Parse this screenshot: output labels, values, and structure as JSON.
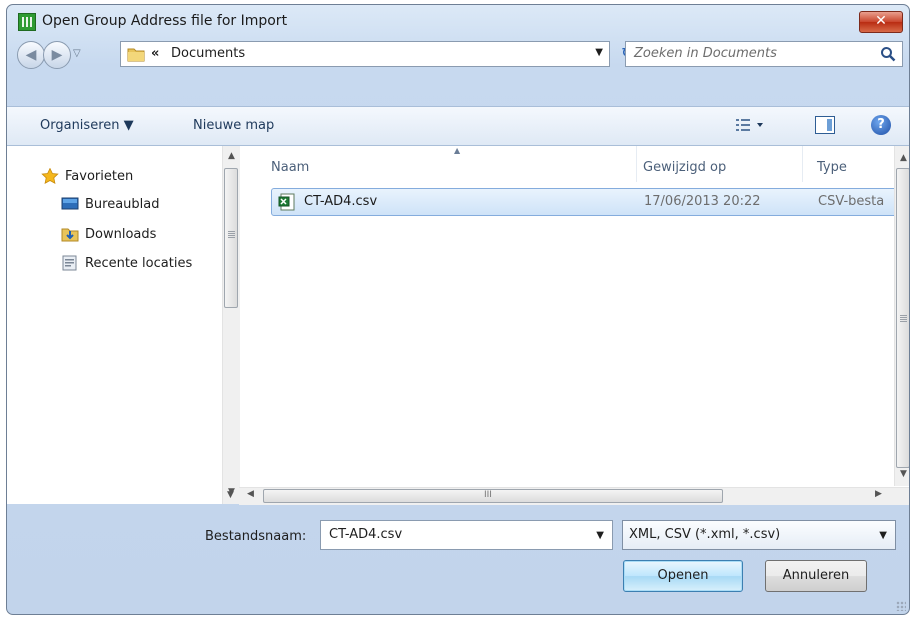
{
  "window": {
    "title": "Open Group Address file for Import",
    "close_glyph": "✕"
  },
  "nav": {
    "back_glyph": "◀",
    "forward_glyph": "▶",
    "history_glyph": "▽",
    "breadcrumb_chevron": "«",
    "address": "Documents",
    "address_drop": "▼",
    "refresh_glyph": "↻",
    "search_placeholder": "Zoeken in Documents"
  },
  "toolbar": {
    "organise": "Organiseren ▼",
    "new_folder": "Nieuwe map",
    "help": "?"
  },
  "sidebar": {
    "items": [
      {
        "label": "Favorieten",
        "icon": "star-icon"
      },
      {
        "label": "Bureaublad",
        "icon": "desktop-icon"
      },
      {
        "label": "Downloads",
        "icon": "downloads-folder-icon"
      },
      {
        "label": "Recente locaties",
        "icon": "recent-places-icon"
      }
    ]
  },
  "columns": {
    "name": "Naam",
    "modified": "Gewijzigd op",
    "type": "Type"
  },
  "files": [
    {
      "name": "CT-AD4.csv",
      "modified": "17/06/2013 20:22",
      "type": "CSV-besta",
      "icon": "csv-file-icon"
    }
  ],
  "scroll_glyphs": {
    "up": "▲",
    "down": "▼",
    "left": "◀",
    "right": "▶",
    "grip": "≡",
    "hgrip": "III"
  },
  "bottom": {
    "filename_label": "Bestandsnaam:",
    "filename_value": "CT-AD4.csv",
    "filetype_value": "XML, CSV (*.xml, *.csv)",
    "drop_glyph": "▼",
    "open_label": "Openen",
    "cancel_label": "Annuleren"
  },
  "colors": {
    "accent": "#3c7fb1",
    "selection": "#cfe3f8",
    "frame": "#c7d9ef"
  }
}
